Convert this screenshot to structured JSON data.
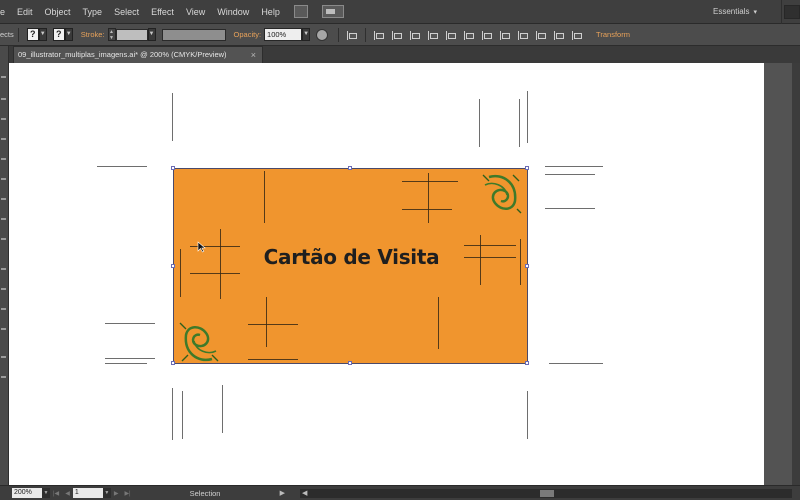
{
  "menubar": {
    "items": [
      "e",
      "Edit",
      "Object",
      "Type",
      "Select",
      "Effect",
      "View",
      "Window",
      "Help"
    ],
    "workspace": "Essentials"
  },
  "controlbar": {
    "left_fragment": "ects",
    "stroke_label": "Stroke:",
    "opacity_label": "Opacity:",
    "opacity_value": "100%",
    "transform_link": "Transform",
    "unknown_glyph": "?"
  },
  "document": {
    "tab_title": "09_illustrator_multiplas_imagens.ai* @ 200% (CMYK/Preview)",
    "close_glyph": "×"
  },
  "artboard": {
    "title": "Cartão de Visita",
    "fill_color": "#f0952e"
  },
  "statusbar": {
    "zoom": "200%",
    "page": "1",
    "tool_status": "Selection"
  },
  "colors": {
    "accent_label": "#e8a25a",
    "ui_dark": "#3f3f3f",
    "ornament_green": "#3f7a2a"
  }
}
